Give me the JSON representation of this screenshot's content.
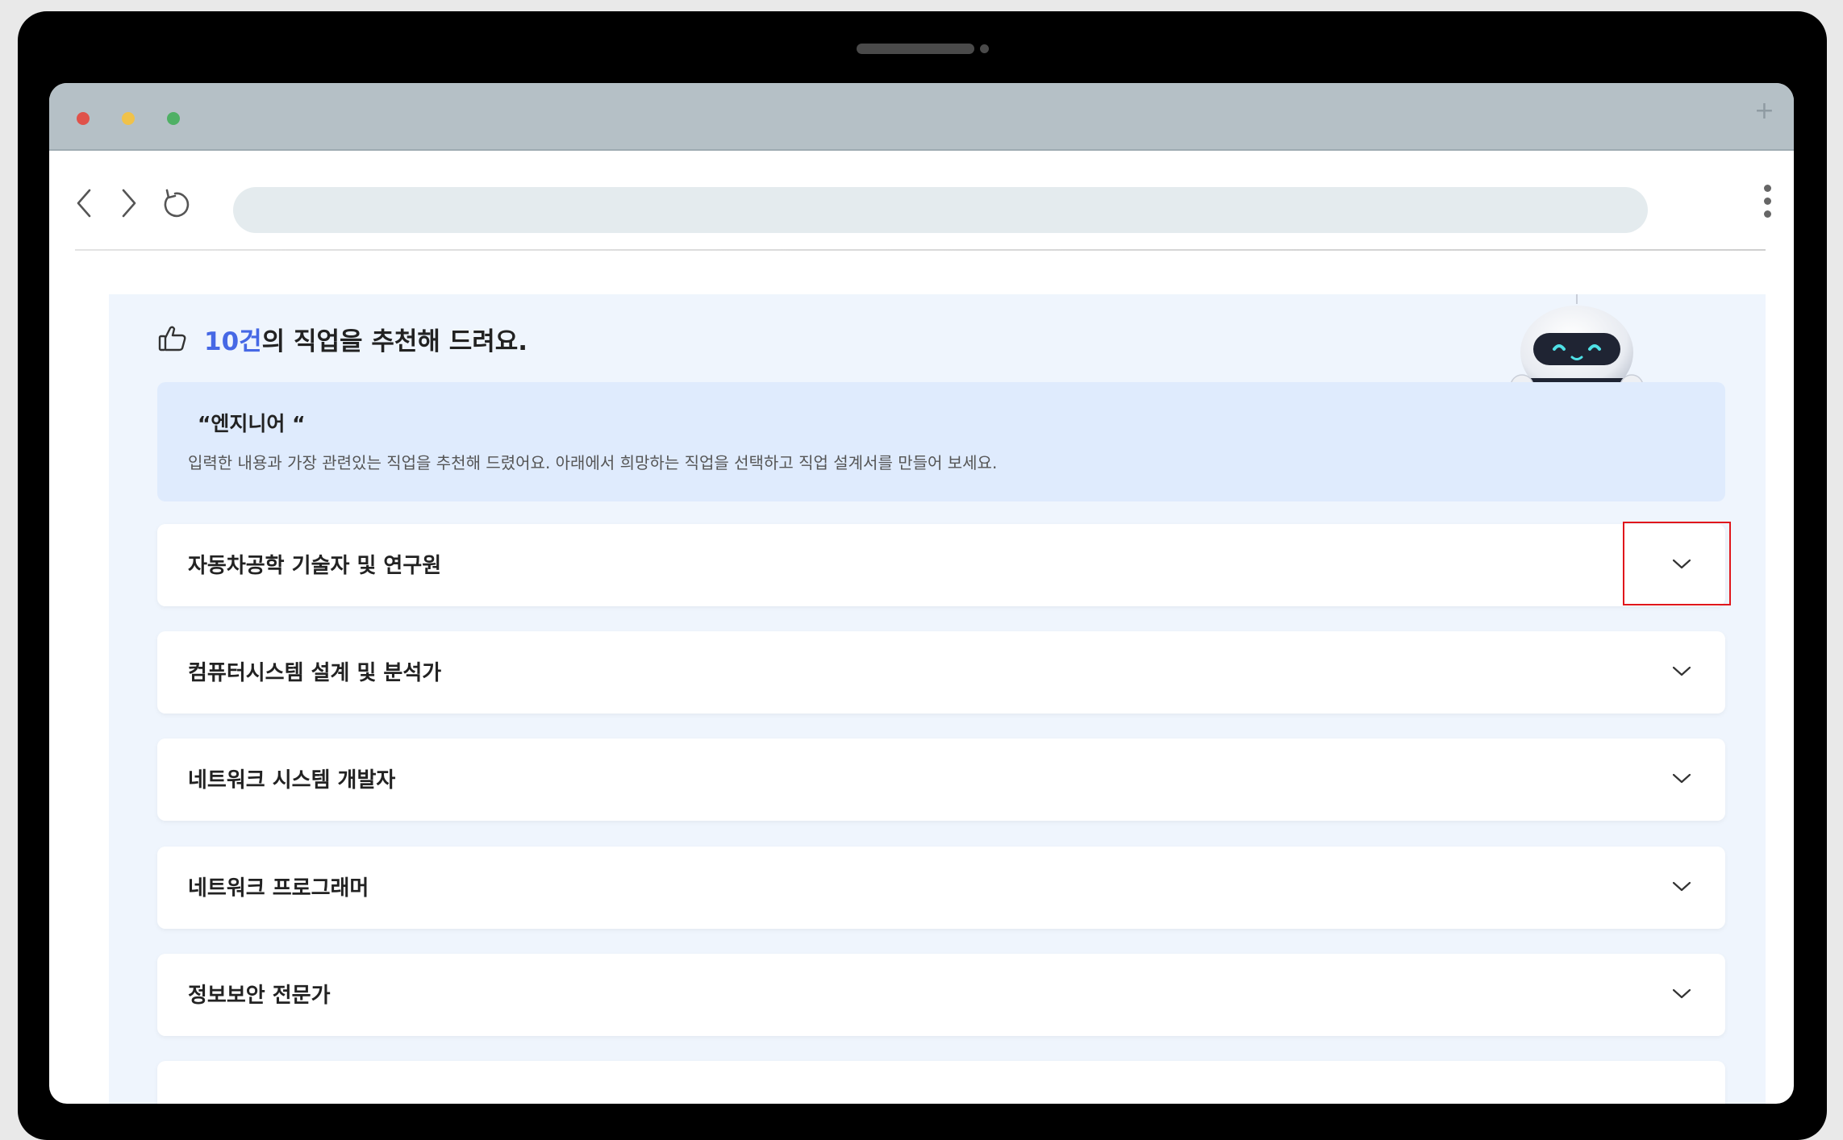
{
  "browser": {
    "address_value": "",
    "new_tab_label": "+"
  },
  "recommend": {
    "count_highlight": "10건",
    "headline_rest": "의 직업을 추천해 드려요."
  },
  "info": {
    "keyword": "“엔지니어 “",
    "description": "입력한 내용과 가장 관련있는 직업을 추천해 드렸어요. 아래에서 희망하는 직업을 선택하고 직업 설계서를 만들어 보세요."
  },
  "jobs": [
    {
      "title": "자동차공학 기술자 및 연구원"
    },
    {
      "title": "컴퓨터시스템 설계 및 분석가"
    },
    {
      "title": "네트워크 시스템 개발자"
    },
    {
      "title": "네트워크 프로그래머"
    },
    {
      "title": "정보보안 전문가"
    }
  ],
  "colors": {
    "accent": "#4668e5",
    "content_bg": "#eff5fd",
    "info_bg": "#dfebfd",
    "highlight": "#e0161b"
  },
  "icons": {
    "back": "chevron-left-icon",
    "forward": "chevron-right-icon",
    "reload": "reload-icon",
    "menu": "kebab-menu-icon",
    "thumb": "thumbs-up-icon",
    "expand": "chevron-down-icon"
  }
}
